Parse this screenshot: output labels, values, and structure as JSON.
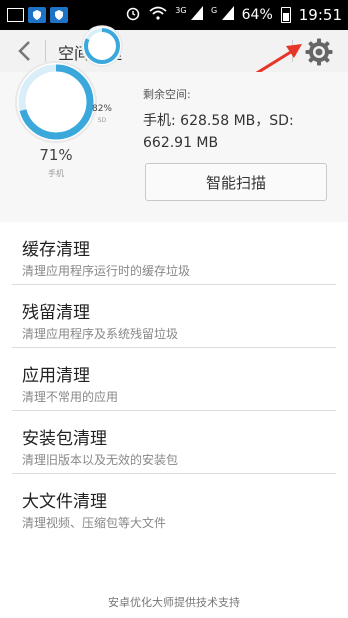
{
  "status_bar": {
    "icons": [
      "image-icon",
      "shield-icon",
      "shield-icon"
    ],
    "signal_label_1": "3G",
    "signal_label_2": "G",
    "battery_percent": "64%",
    "time": "19:51"
  },
  "toolbar": {
    "title": "空间清理",
    "back_icon": "back-chevron-icon",
    "settings_icon": "gear-icon"
  },
  "storage": {
    "phone_percent": "71%",
    "phone_label": "手机",
    "phone_fraction": 0.71,
    "sd_percent": "82%",
    "sd_label": "SD",
    "sd_fraction": 0.82,
    "remaining_label": "剩余空间:",
    "remaining_value": "手机: 628.58 MB，SD: 662.91 MB",
    "scan_button": "智能扫描"
  },
  "list": [
    {
      "title": "缓存清理",
      "subtitle": "清理应用程序运行时的缓存垃圾"
    },
    {
      "title": "残留清理",
      "subtitle": "清理应用程序及系统残留垃圾"
    },
    {
      "title": "应用清理",
      "subtitle": "清理不常用的应用"
    },
    {
      "title": "安装包清理",
      "subtitle": "清理旧版本以及无效的安装包"
    },
    {
      "title": "大文件清理",
      "subtitle": "清理视频、压缩包等大文件"
    }
  ],
  "footer": "安卓优化大师提供技术支持",
  "colors": {
    "ring_blue": "#3ba8dc",
    "ring_track": "#d9eef8",
    "annotation_arrow": "#e8352a"
  }
}
